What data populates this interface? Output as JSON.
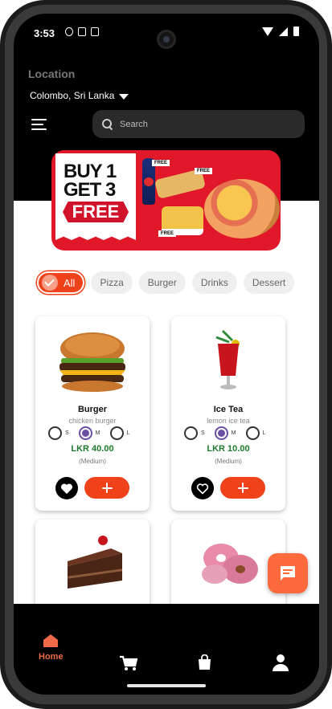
{
  "status_bar": {
    "time": "3:53"
  },
  "header": {
    "location_label": "Location",
    "location_value": "Colombo, Sri Lanka",
    "search_placeholder": "Search"
  },
  "banner": {
    "line1": "BUY 1",
    "line2": "GET 3",
    "line3": "FREE",
    "tag": "FREE"
  },
  "categories": [
    {
      "label": "All",
      "active": true
    },
    {
      "label": "Pizza"
    },
    {
      "label": "Burger"
    },
    {
      "label": "Drinks"
    },
    {
      "label": "Dessert"
    }
  ],
  "products": [
    {
      "name": "Burger",
      "description": "chicken burger",
      "sizes": [
        "S",
        "M",
        "L"
      ],
      "selected_size": "M",
      "price": "LKR 40.00",
      "note": "(Medium)",
      "favorite": true
    },
    {
      "name": "Ice Tea",
      "description": "lemon ice tea",
      "sizes": [
        "S",
        "M",
        "L"
      ],
      "selected_size": "M",
      "price": "LKR 10.00",
      "note": "(Medium)",
      "favorite": false
    }
  ],
  "nav": {
    "home_label": "Home"
  },
  "colors": {
    "accent": "#f0421a",
    "price_green": "#1e7b2c",
    "radio_purple": "#6b4fa3",
    "fab": "#ff6a3d",
    "nav_active": "#f06a4a"
  },
  "icons": [
    "menu-icon",
    "search-icon",
    "heart-icon",
    "plus-icon",
    "chat-icon",
    "home-icon",
    "cart-icon",
    "bag-icon",
    "user-icon"
  ]
}
